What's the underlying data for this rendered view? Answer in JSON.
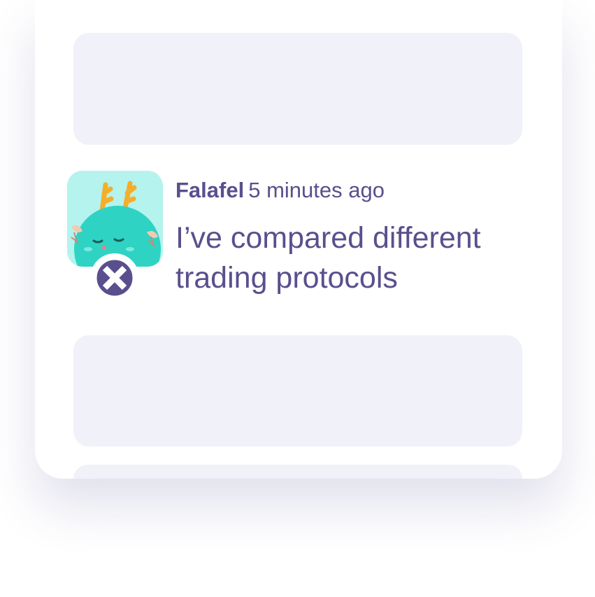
{
  "message": {
    "author": "Falafel",
    "timestamp": "5 minutes ago",
    "text": "I’ve compared different trading protocols",
    "avatar_icon": "dragon-avatar-icon",
    "badge_icon": "0x-protocol-logo-icon"
  },
  "colors": {
    "text": "#5a4f8d",
    "placeholder": "#f1f1f9",
    "avatar_bg": "#b4f3ee",
    "badge_icon": "#5a4f8d"
  }
}
